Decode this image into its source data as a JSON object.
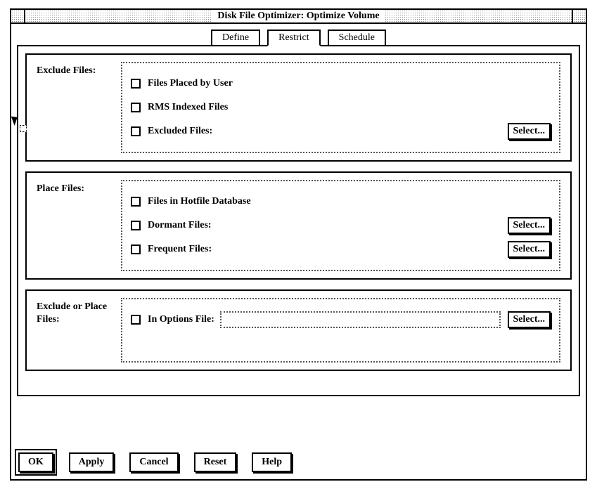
{
  "window": {
    "title": "Disk File Optimizer: Optimize Volume"
  },
  "tabs": {
    "define": "Define",
    "restrict": "Restrict",
    "schedule": "Schedule",
    "selected": "Restrict"
  },
  "sections": {
    "exclude": {
      "label": "Exclude Files:",
      "opt1": "Files Placed by User",
      "opt2": "RMS Indexed Files",
      "opt3": "Excluded Files:",
      "select": "Select..."
    },
    "place": {
      "label": "Place Files:",
      "opt1": "Files in Hotfile Database",
      "opt2": "Dormant Files:",
      "opt3": "Frequent Files:",
      "select": "Select..."
    },
    "options": {
      "label": "Exclude or Place Files:",
      "opt1": "In Options File:",
      "value": "",
      "select": "Select..."
    }
  },
  "buttons": {
    "ok": "OK",
    "apply": "Apply",
    "cancel": "Cancel",
    "reset": "Reset",
    "help": "Help"
  }
}
